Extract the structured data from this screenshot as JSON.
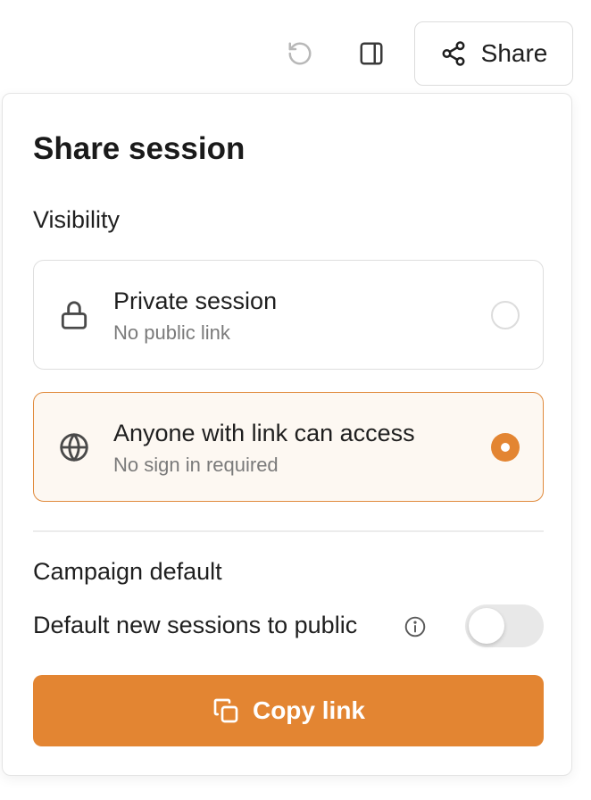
{
  "toolbar": {
    "history_icon": "rotate-ccw-icon",
    "panel_icon": "sidebar-panel-icon",
    "share_label": "Share",
    "share_icon": "share-nodes-icon"
  },
  "popover": {
    "title": "Share session",
    "visibility_label": "Visibility",
    "options": [
      {
        "title": "Private session",
        "subtitle": "No public link",
        "icon": "lock-icon",
        "selected": false
      },
      {
        "title": "Anyone with link can access",
        "subtitle": "No sign in required",
        "icon": "globe-icon",
        "selected": true
      }
    ],
    "campaign_label": "Campaign default",
    "default_public_label": "Default new sessions to public",
    "default_public_enabled": false,
    "copy_label": "Copy link",
    "copy_icon": "copy-icon"
  },
  "colors": {
    "accent": "#e38532",
    "selected_bg": "#fdf8f2",
    "border": "#dedede"
  }
}
